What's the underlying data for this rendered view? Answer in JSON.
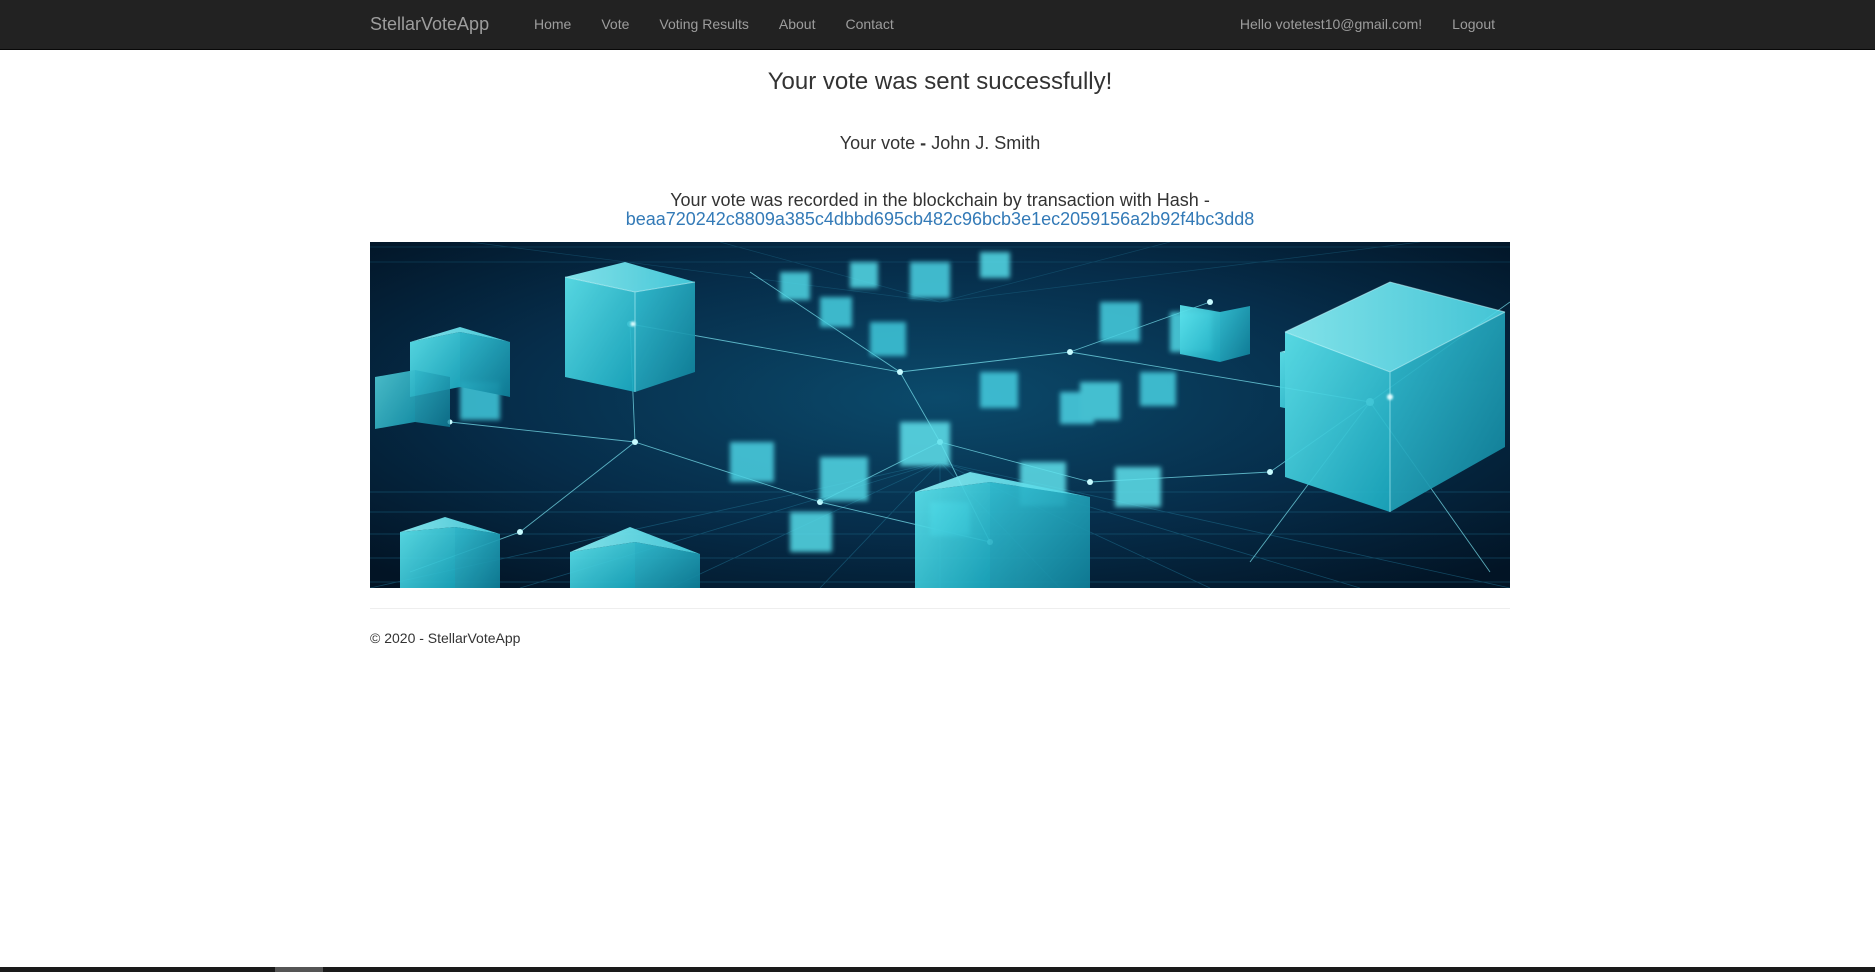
{
  "navbar": {
    "brand": "StellarVoteApp",
    "links": [
      "Home",
      "Vote",
      "Voting Results",
      "About",
      "Contact"
    ],
    "greeting": "Hello votetest10@gmail.com!",
    "logout": "Logout"
  },
  "main": {
    "title": "Your vote was sent successfully!",
    "vote_prefix": "Your vote",
    "vote_dash": "-",
    "candidate": "John J. Smith",
    "hash_text": "Your vote was recorded in the blockchain by transaction with Hash -",
    "hash_value": "beaa720242c8809a385c4dbbd695cb482c96bcb3e1ec2059156a2b92f4bc3dd8"
  },
  "footer": {
    "text": "© 2020 - StellarVoteApp"
  },
  "colors": {
    "navbar_bg": "#222222",
    "nav_text": "#9d9d9d",
    "link": "#337ab7",
    "banner_dark": "#03203a",
    "banner_cube": "#3fd4e0"
  },
  "icons": {
    "banner": "blockchain-cubes-image"
  }
}
